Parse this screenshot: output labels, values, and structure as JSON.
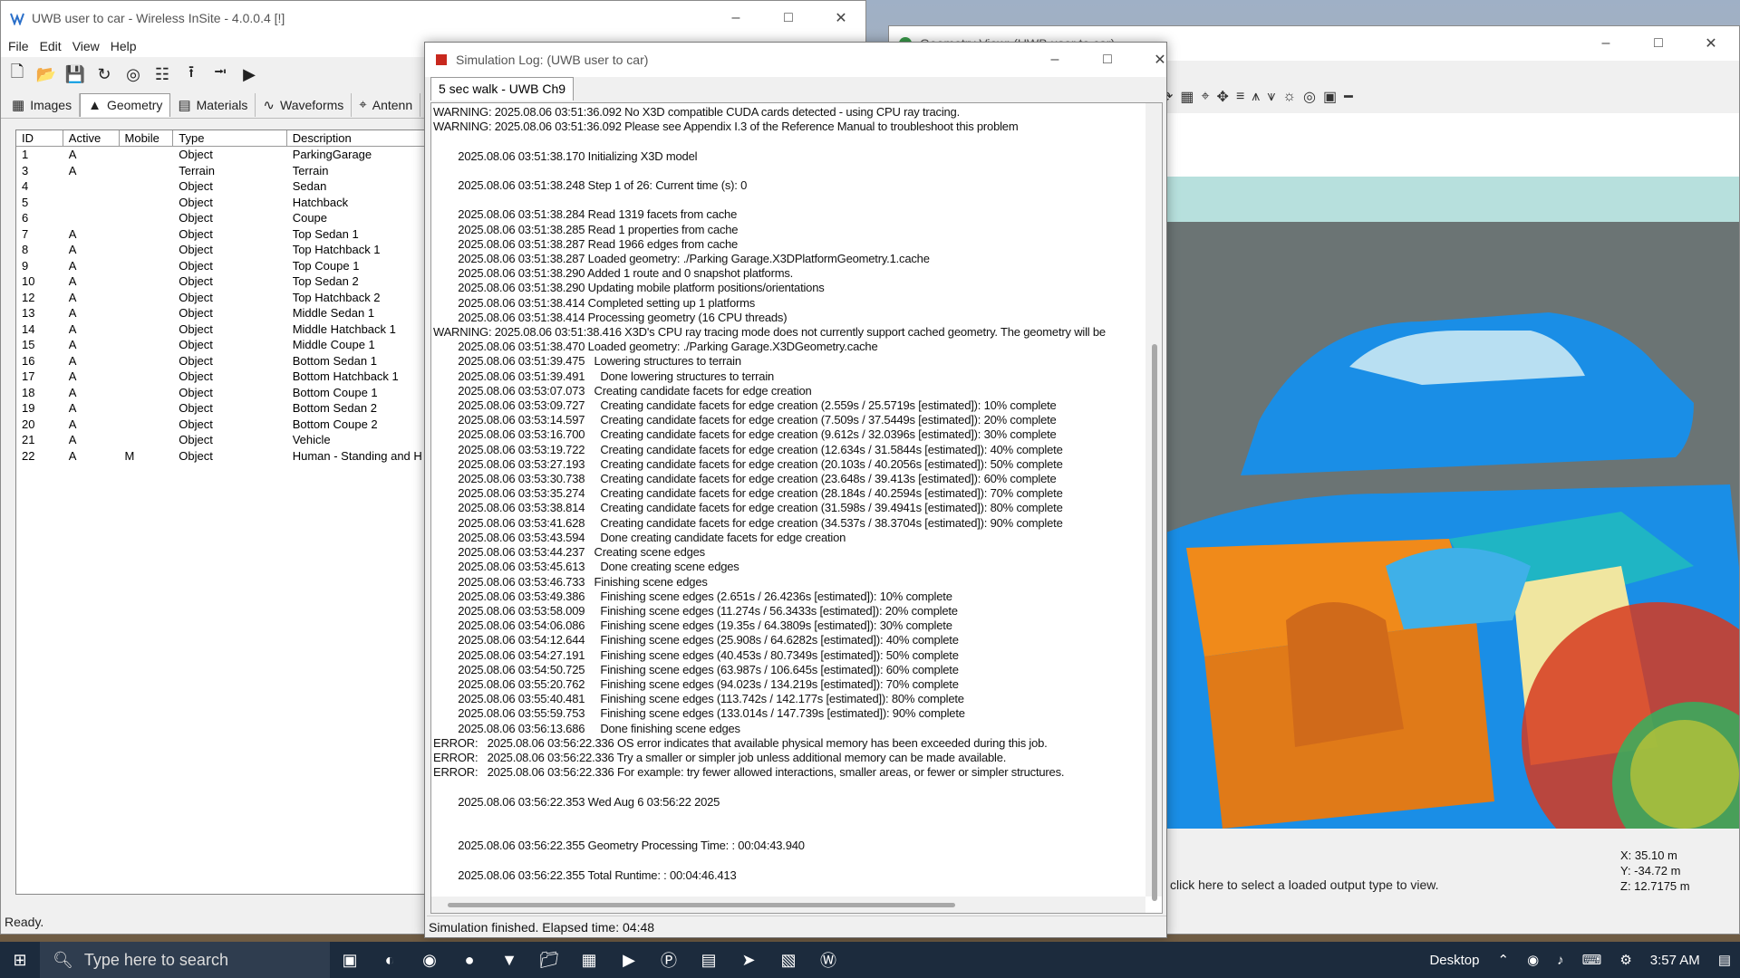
{
  "main_window": {
    "title": "UWB user to car - Wireless InSite - 4.0.0.4 [!]",
    "menu": [
      "File",
      "Edit",
      "View",
      "Help"
    ],
    "tabs": [
      {
        "label": "Images",
        "icon": "images-icon"
      },
      {
        "label": "Geometry",
        "icon": "geometry-icon"
      },
      {
        "label": "Materials",
        "icon": "materials-icon"
      },
      {
        "label": "Waveforms",
        "icon": "waveforms-icon"
      },
      {
        "label": "Antenn",
        "icon": "antenna-icon"
      }
    ],
    "columns": [
      "ID",
      "Active",
      "Mobile",
      "Type",
      "Description"
    ],
    "rows": [
      [
        "1",
        "A",
        "",
        "Object",
        "ParkingGarage"
      ],
      [
        "3",
        "A",
        "",
        "Terrain",
        "Terrain"
      ],
      [
        "4",
        "",
        "",
        "Object",
        "Sedan"
      ],
      [
        "5",
        "",
        "",
        "Object",
        "Hatchback"
      ],
      [
        "6",
        "",
        "",
        "Object",
        "Coupe"
      ],
      [
        "7",
        "A",
        "",
        "Object",
        "Top Sedan 1"
      ],
      [
        "8",
        "A",
        "",
        "Object",
        "Top Hatchback 1"
      ],
      [
        "9",
        "A",
        "",
        "Object",
        "Top Coupe 1"
      ],
      [
        "10",
        "A",
        "",
        "Object",
        "Top Sedan 2"
      ],
      [
        "12",
        "A",
        "",
        "Object",
        "Top Hatchback 2"
      ],
      [
        "13",
        "A",
        "",
        "Object",
        "Middle Sedan 1"
      ],
      [
        "14",
        "A",
        "",
        "Object",
        "Middle Hatchback 1"
      ],
      [
        "15",
        "A",
        "",
        "Object",
        "Middle Coupe 1"
      ],
      [
        "16",
        "A",
        "",
        "Object",
        "Bottom Sedan 1"
      ],
      [
        "17",
        "A",
        "",
        "Object",
        "Bottom Hatchback 1"
      ],
      [
        "18",
        "A",
        "",
        "Object",
        "Bottom Coupe 1"
      ],
      [
        "19",
        "A",
        "",
        "Object",
        "Bottom Sedan 2"
      ],
      [
        "20",
        "A",
        "",
        "Object",
        "Bottom Coupe 2"
      ],
      [
        "21",
        "A",
        "",
        "Object",
        "Vehicle"
      ],
      [
        "22",
        "A",
        "M",
        "Object",
        "Human - Standing and H"
      ]
    ],
    "status": "Ready."
  },
  "geometry_window": {
    "title": "Geometry View: (UWB user to car)",
    "message": "click here to select a loaded output type to view.",
    "coords": {
      "x": "X: 35.10 m",
      "y": "Y: -34.72 m",
      "z": "Z: 12.7175 m"
    }
  },
  "log_window": {
    "title": "Simulation Log: (UWB user to car)",
    "tab": "5 sec walk - UWB Ch9",
    "lines": [
      "WARNING: 2025.08.06 03:51:36.092 No X3D compatible CUDA cards detected - using CPU ray tracing.",
      "WARNING: 2025.08.06 03:51:36.092 Please see Appendix I.3 of the Reference Manual to troubleshoot this problem",
      "",
      "        2025.08.06 03:51:38.170 Initializing X3D model",
      "",
      "        2025.08.06 03:51:38.248 Step 1 of 26: Current time (s): 0",
      "",
      "        2025.08.06 03:51:38.284 Read 1319 facets from cache",
      "        2025.08.06 03:51:38.285 Read 1 properties from cache",
      "        2025.08.06 03:51:38.287 Read 1966 edges from cache",
      "        2025.08.06 03:51:38.287 Loaded geometry: ./Parking Garage.X3DPlatformGeometry.1.cache",
      "        2025.08.06 03:51:38.290 Added 1 route and 0 snapshot platforms.",
      "        2025.08.06 03:51:38.290 Updating mobile platform positions/orientations",
      "        2025.08.06 03:51:38.414 Completed setting up 1 platforms",
      "        2025.08.06 03:51:38.414 Processing geometry (16 CPU threads)",
      "WARNING: 2025.08.06 03:51:38.416 X3D's CPU ray tracing mode does not currently support cached geometry. The geometry will be",
      "        2025.08.06 03:51:38.470 Loaded geometry: ./Parking Garage.X3DGeometry.cache",
      "        2025.08.06 03:51:39.475   Lowering structures to terrain",
      "        2025.08.06 03:51:39.491     Done lowering structures to terrain",
      "        2025.08.06 03:53:07.073   Creating candidate facets for edge creation",
      "        2025.08.06 03:53:09.727     Creating candidate facets for edge creation (2.559s / 25.5719s [estimated]): 10% complete",
      "        2025.08.06 03:53:14.597     Creating candidate facets for edge creation (7.509s / 37.5449s [estimated]): 20% complete",
      "        2025.08.06 03:53:16.700     Creating candidate facets for edge creation (9.612s / 32.0396s [estimated]): 30% complete",
      "        2025.08.06 03:53:19.722     Creating candidate facets for edge creation (12.634s / 31.5844s [estimated]): 40% complete",
      "        2025.08.06 03:53:27.193     Creating candidate facets for edge creation (20.103s / 40.2056s [estimated]): 50% complete",
      "        2025.08.06 03:53:30.738     Creating candidate facets for edge creation (23.648s / 39.413s [estimated]): 60% complete",
      "        2025.08.06 03:53:35.274     Creating candidate facets for edge creation (28.184s / 40.2594s [estimated]): 70% complete",
      "        2025.08.06 03:53:38.814     Creating candidate facets for edge creation (31.598s / 39.4941s [estimated]): 80% complete",
      "        2025.08.06 03:53:41.628     Creating candidate facets for edge creation (34.537s / 38.3704s [estimated]): 90% complete",
      "        2025.08.06 03:53:43.594     Done creating candidate facets for edge creation",
      "        2025.08.06 03:53:44.237   Creating scene edges",
      "        2025.08.06 03:53:45.613     Done creating scene edges",
      "        2025.08.06 03:53:46.733   Finishing scene edges",
      "        2025.08.06 03:53:49.386     Finishing scene edges (2.651s / 26.4236s [estimated]): 10% complete",
      "        2025.08.06 03:53:58.009     Finishing scene edges (11.274s / 56.3433s [estimated]): 20% complete",
      "        2025.08.06 03:54:06.086     Finishing scene edges (19.35s / 64.3809s [estimated]): 30% complete",
      "        2025.08.06 03:54:12.644     Finishing scene edges (25.908s / 64.6282s [estimated]): 40% complete",
      "        2025.08.06 03:54:27.191     Finishing scene edges (40.453s / 80.7349s [estimated]): 50% complete",
      "        2025.08.06 03:54:50.725     Finishing scene edges (63.987s / 106.645s [estimated]): 60% complete",
      "        2025.08.06 03:55:20.762     Finishing scene edges (94.023s / 134.219s [estimated]): 70% complete",
      "        2025.08.06 03:55:40.481     Finishing scene edges (113.742s / 142.177s [estimated]): 80% complete",
      "        2025.08.06 03:55:59.753     Finishing scene edges (133.014s / 147.739s [estimated]): 90% complete",
      "        2025.08.06 03:56:13.686     Done finishing scene edges",
      "ERROR:   2025.08.06 03:56:22.336 OS error indicates that available physical memory has been exceeded during this job.",
      "ERROR:   2025.08.06 03:56:22.336 Try a smaller or simpler job unless additional memory can be made available.",
      "ERROR:   2025.08.06 03:56:22.336 For example: try fewer allowed interactions, smaller areas, or fewer or simpler structures.",
      "",
      "        2025.08.06 03:56:22.353 Wed Aug 6 03:56:22 2025",
      "",
      "",
      "        2025.08.06 03:56:22.355 Geometry Processing Time: : 00:04:43.940",
      "",
      "        2025.08.06 03:56:22.355 Total Runtime: : 00:04:46.413"
    ],
    "status": "Simulation finished.  Elapsed time: 04:48"
  },
  "taskbar": {
    "search_placeholder": "Type here to search",
    "desktop_label": "Desktop",
    "time": "3:57 AM"
  },
  "colors": {
    "car_blue": "#1a8ee6",
    "car_orange": "#f08a1a",
    "car_cyan": "#1fb5c4",
    "scene_bg": "#b7e0dd"
  }
}
